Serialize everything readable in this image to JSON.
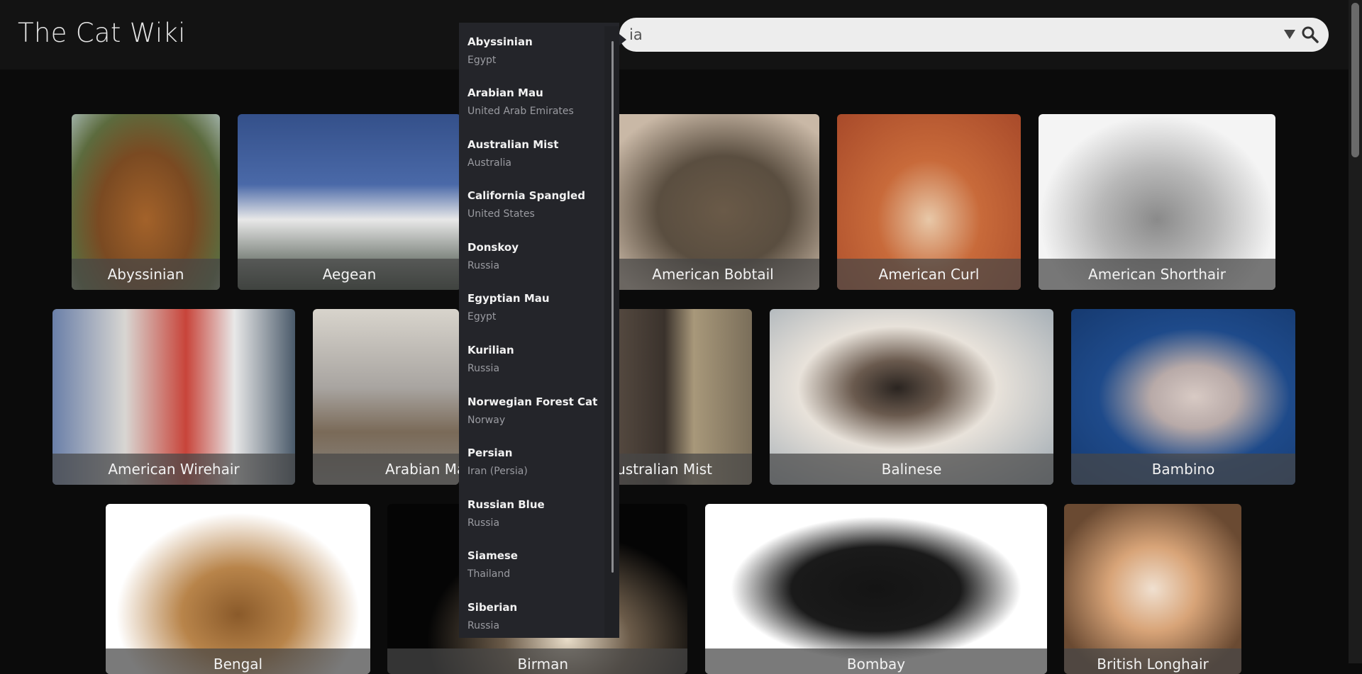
{
  "header": {
    "title": "The Cat Wiki"
  },
  "search": {
    "value": "ia",
    "dropdown_icon": "triangle-down-icon",
    "search_icon": "search-icon"
  },
  "gallery": {
    "rows": [
      [
        {
          "name": "Abyssinian"
        },
        {
          "name": "Aegean"
        },
        {
          "name": "American Bobtail"
        },
        {
          "name": "American Curl"
        },
        {
          "name": "American Shorthair"
        }
      ],
      [
        {
          "name": "American Wirehair"
        },
        {
          "name": "Arabian Mau"
        },
        {
          "name": "Australian Mist"
        },
        {
          "name": "Balinese"
        },
        {
          "name": "Bambino"
        }
      ],
      [
        {
          "name": "Bengal"
        },
        {
          "name": "Birman"
        },
        {
          "name": "Bombay"
        },
        {
          "name": "British Longhair"
        }
      ]
    ]
  },
  "dropdown": {
    "items": [
      {
        "name": "Abyssinian",
        "origin": "Egypt"
      },
      {
        "name": "Arabian Mau",
        "origin": "United Arab Emirates"
      },
      {
        "name": "Australian Mist",
        "origin": "Australia"
      },
      {
        "name": "California Spangled",
        "origin": "United States"
      },
      {
        "name": "Donskoy",
        "origin": "Russia"
      },
      {
        "name": "Egyptian Mau",
        "origin": "Egypt"
      },
      {
        "name": "Kurilian",
        "origin": "Russia"
      },
      {
        "name": "Norwegian Forest Cat",
        "origin": "Norway"
      },
      {
        "name": "Persian",
        "origin": "Iran (Persia)"
      },
      {
        "name": "Russian Blue",
        "origin": "Russia"
      },
      {
        "name": "Siamese",
        "origin": "Thailand"
      },
      {
        "name": "Siberian",
        "origin": "Russia"
      }
    ]
  }
}
